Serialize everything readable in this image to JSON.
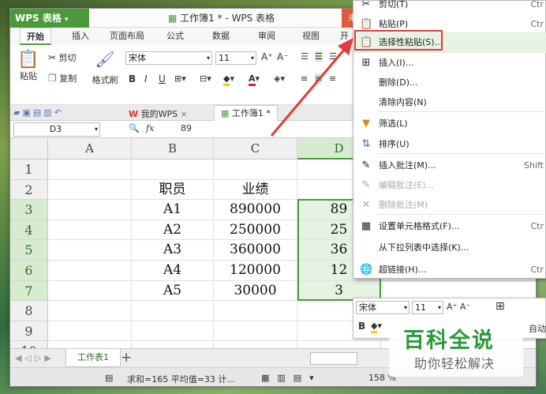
{
  "titlebar": {
    "app_button": "WPS 表格",
    "title": "工作簿1 * - WPS 表格",
    "right_partial": "未"
  },
  "menu_tabs": [
    "开始",
    "插入",
    "页面布局",
    "公式",
    "数据",
    "审阅",
    "视图",
    "开"
  ],
  "ribbon": {
    "paste": "粘贴",
    "cut": "剪切",
    "copy": "复制",
    "format_painter": "格式刷",
    "font_name": "宋体",
    "font_size": "11",
    "bold": "B",
    "italic": "I",
    "underline": "U",
    "grow": "A⁺",
    "shrink": "A⁻"
  },
  "doc_tabs": {
    "mywps": "我的WPS",
    "workbook": "工作簿1 *"
  },
  "formula_bar": {
    "name_box": "D3",
    "fx": "fx",
    "value": "89"
  },
  "sheet": {
    "columns": [
      "A",
      "B",
      "C",
      "D"
    ],
    "rows": [
      {
        "num": "1",
        "cells": [
          "",
          "",
          "",
          ""
        ]
      },
      {
        "num": "2",
        "cells": [
          "",
          "职员",
          "业绩",
          ""
        ]
      },
      {
        "num": "3",
        "cells": [
          "",
          "A1",
          "890000",
          "89"
        ]
      },
      {
        "num": "4",
        "cells": [
          "",
          "A2",
          "250000",
          "25"
        ]
      },
      {
        "num": "5",
        "cells": [
          "",
          "A3",
          "360000",
          "36"
        ]
      },
      {
        "num": "6",
        "cells": [
          "",
          "A4",
          "120000",
          "12"
        ]
      },
      {
        "num": "7",
        "cells": [
          "",
          "A5",
          "30000",
          "3"
        ]
      },
      {
        "num": "8",
        "cells": [
          "",
          "",
          "",
          ""
        ]
      },
      {
        "num": "9",
        "cells": [
          "",
          "",
          "",
          ""
        ]
      },
      {
        "num": "10",
        "cells": [
          "",
          "",
          "",
          ""
        ]
      }
    ]
  },
  "sheetbar": {
    "sheet_tab": "工作表1",
    "add": "+"
  },
  "statusbar": {
    "summary": "求和=165  平均值=33  计...",
    "zoom": "158 %"
  },
  "context_menu": {
    "items": [
      {
        "icon": "cut-icon",
        "label": "剪切(T)",
        "shortcut": "Ctr",
        "disabled": false
      },
      {
        "icon": "paste-icon",
        "label": "粘贴(P)",
        "shortcut": "Ctr",
        "disabled": false
      },
      {
        "icon": "paste-special-icon",
        "label": "选择性粘贴(S)...",
        "shortcut": "",
        "disabled": false
      },
      {
        "icon": "insert-icon",
        "label": "插入(I)...",
        "shortcut": "",
        "disabled": false
      },
      {
        "icon": "",
        "label": "删除(D)...",
        "shortcut": "",
        "disabled": false
      },
      {
        "icon": "",
        "label": "清除内容(N)",
        "shortcut": "",
        "disabled": false
      },
      {
        "icon": "filter-icon",
        "label": "筛选(L)",
        "shortcut": "",
        "disabled": false
      },
      {
        "icon": "sort-icon",
        "label": "排序(U)",
        "shortcut": "",
        "disabled": false
      },
      {
        "icon": "comment-icon",
        "label": "插入批注(M)...",
        "shortcut": "Shift",
        "disabled": false
      },
      {
        "icon": "edit-comment-icon",
        "label": "编辑批注(E)...",
        "shortcut": "",
        "disabled": true
      },
      {
        "icon": "delete-comment-icon",
        "label": "删除批注(M)",
        "shortcut": "",
        "disabled": true
      },
      {
        "icon": "format-cells-icon",
        "label": "设置单元格格式(F)...",
        "shortcut": "Ctr",
        "disabled": false
      },
      {
        "icon": "",
        "label": "从下拉列表中选择(K)...",
        "shortcut": "",
        "disabled": false
      },
      {
        "icon": "hyperlink-icon",
        "label": "超链接(H)...",
        "shortcut": "Ctr",
        "disabled": false
      }
    ]
  },
  "mini_toolbar": {
    "font_name": "宋体",
    "font_size": "11",
    "bold": "B",
    "auto": "自动"
  },
  "watermark": {
    "title": "百科全说",
    "subtitle": "助你轻松解决"
  },
  "colors": {
    "accent": "#4a9a3a",
    "highlight": "#e23a3a"
  }
}
